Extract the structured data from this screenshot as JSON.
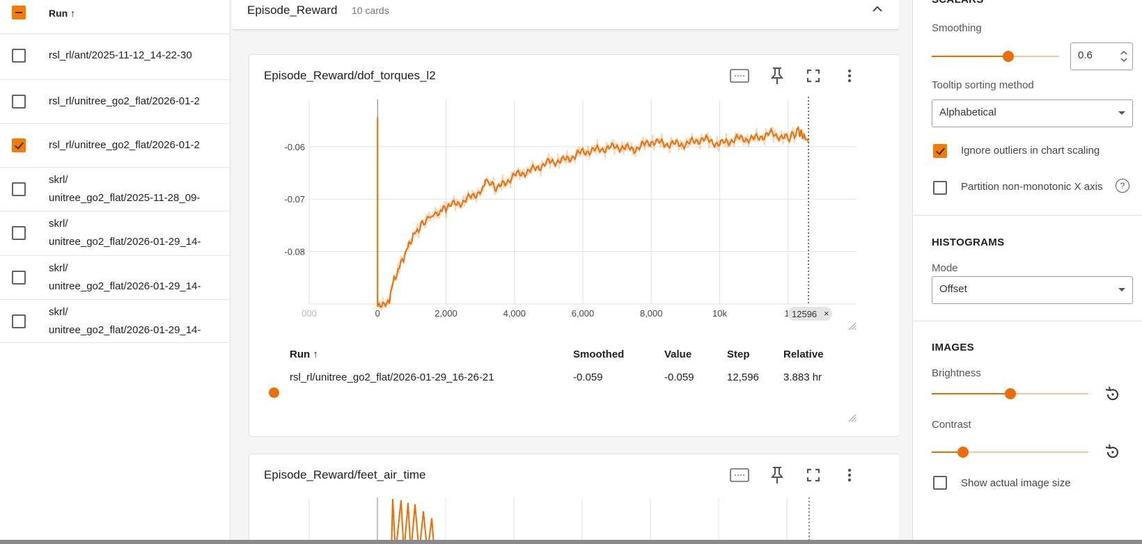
{
  "runs": {
    "header_label": "Run ↑",
    "items": [
      {
        "lines": [
          "rsl_rl/ant/2025-11-12_14-22-30"
        ],
        "checked": false
      },
      {
        "lines": [
          "rsl_rl/unitree_go2_flat/2026-01-2"
        ],
        "checked": false
      },
      {
        "lines": [
          "rsl_rl/unitree_go2_flat/2026-01-2"
        ],
        "checked": true
      },
      {
        "lines": [
          "skrl/",
          "unitree_go2_flat/2025-11-28_09-"
        ],
        "checked": false
      },
      {
        "lines": [
          "skrl/",
          "unitree_go2_flat/2026-01-29_14-"
        ],
        "checked": false
      },
      {
        "lines": [
          "skrl/",
          "unitree_go2_flat/2026-01-29_14-"
        ],
        "checked": false
      },
      {
        "lines": [
          "skrl/",
          "unitree_go2_flat/2026-01-29_14-"
        ],
        "checked": false
      }
    ]
  },
  "group": {
    "title": "Episode_Reward",
    "count": "10 cards"
  },
  "card1": {
    "title": "Episode_Reward/dof_torques_l2",
    "table": {
      "headers": [
        "Run ↑",
        "Smoothed",
        "Value",
        "Step",
        "Relative"
      ],
      "row": {
        "run": "rsl_rl/unitree_go2_flat/2026-01-29_16-26-21",
        "smoothed": "-0.059",
        "value": "-0.059",
        "step": "12,596",
        "relative": "3.883 hr"
      }
    },
    "cursor_label": "12596",
    "cursor_close": "×"
  },
  "card2": {
    "title": "Episode_Reward/feet_air_time"
  },
  "chart_data": {
    "type": "line",
    "title": "Episode_Reward/dof_torques_l2",
    "xlabel": "",
    "ylabel": "",
    "xlim": [
      -2000,
      14000
    ],
    "ylim": [
      -0.09,
      -0.051
    ],
    "x_ticks": [
      "000",
      "0",
      "2,000",
      "4,000",
      "6,000",
      "8,000",
      "10k",
      "1:"
    ],
    "y_ticks": [
      "-0.06",
      "-0.07",
      "-0.08"
    ],
    "series": [
      {
        "color": "#ef6c00",
        "x": [
          0,
          0,
          350,
          400,
          600,
          800,
          1000,
          1200,
          1500,
          1800,
          2000,
          2500,
          3000,
          3200,
          3500,
          4000,
          4500,
          5000,
          5500,
          6000,
          6500,
          7000,
          7500,
          8000,
          8500,
          9000,
          9500,
          10000,
          10500,
          11000,
          11500,
          12000,
          12300,
          12596
        ],
        "y": [
          -0.0545,
          -0.0905,
          -0.0895,
          -0.087,
          -0.0835,
          -0.0805,
          -0.0775,
          -0.0755,
          -0.0735,
          -0.0725,
          -0.0715,
          -0.0705,
          -0.0685,
          -0.0665,
          -0.068,
          -0.0655,
          -0.0645,
          -0.063,
          -0.0625,
          -0.061,
          -0.0605,
          -0.06,
          -0.0605,
          -0.059,
          -0.0595,
          -0.0595,
          -0.0585,
          -0.0595,
          -0.0585,
          -0.0585,
          -0.0575,
          -0.0585,
          -0.057,
          -0.059
        ]
      }
    ],
    "cursor_step": 12596,
    "grid": true
  },
  "settings": {
    "scalars_title": "SCALARS",
    "smoothing_label": "Smoothing",
    "smoothing_value": "0.6",
    "smoothing_fraction": 0.6,
    "tooltip_label": "Tooltip sorting method",
    "tooltip_value": "Alphabetical",
    "ignore_outliers_label": "Ignore outliers in chart scaling",
    "partition_label": "Partition non-monotonic X axis",
    "help_glyph": "?",
    "histograms_title": "HISTOGRAMS",
    "mode_label": "Mode",
    "mode_value": "Offset",
    "images_title": "IMAGES",
    "brightness_label": "Brightness",
    "brightness_fraction": 0.5,
    "contrast_label": "Contrast",
    "contrast_fraction": 0.2,
    "actual_size_label": "Show actual image size"
  },
  "colors": {
    "accent": "#ef6c00",
    "accent_light": "#f4c79a",
    "checkbox_fill": "#f57c00"
  }
}
